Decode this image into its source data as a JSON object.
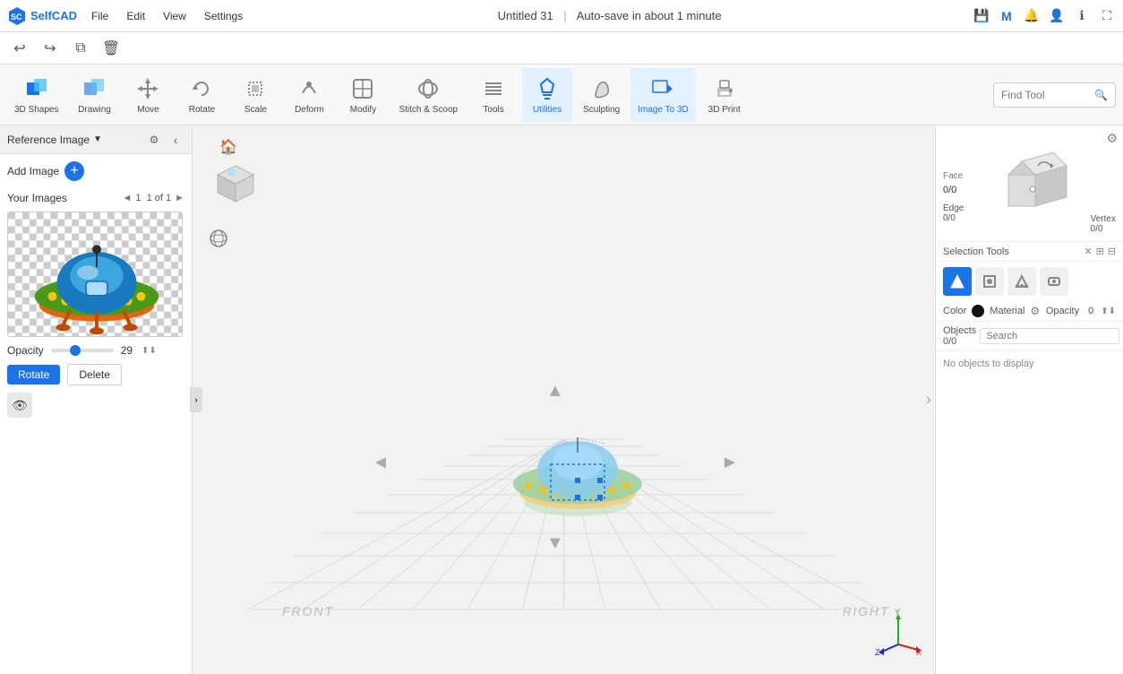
{
  "app": {
    "name": "SelfCAD",
    "title": "Untitled 31",
    "autosave": "Auto-save in about 1 minute"
  },
  "menubar": {
    "items": [
      "File",
      "Edit",
      "View",
      "Settings"
    ]
  },
  "toolbar": {
    "undo_label": "↩",
    "redo_label": "↪",
    "copy_label": "⧉",
    "delete_label": "🗑"
  },
  "main_toolbar": {
    "tools": [
      {
        "id": "3d-shapes",
        "label": "3D Shapes",
        "has_arrow": true
      },
      {
        "id": "drawing",
        "label": "Drawing",
        "has_arrow": true
      },
      {
        "id": "move",
        "label": "Move",
        "has_arrow": false
      },
      {
        "id": "rotate",
        "label": "Rotate",
        "has_arrow": false
      },
      {
        "id": "scale",
        "label": "Scale",
        "has_arrow": false
      },
      {
        "id": "deform",
        "label": "Deform",
        "has_arrow": true
      },
      {
        "id": "modify",
        "label": "Modify",
        "has_arrow": true
      },
      {
        "id": "stitch-scoop",
        "label": "Stitch & Scoop",
        "has_arrow": false
      },
      {
        "id": "tools",
        "label": "Tools",
        "has_arrow": true
      },
      {
        "id": "utilities",
        "label": "Utilities",
        "has_arrow": true,
        "active": true
      },
      {
        "id": "sculpting",
        "label": "Sculpting",
        "has_arrow": false
      },
      {
        "id": "image-to-3d",
        "label": "Image To 3D",
        "has_arrow": false
      },
      {
        "id": "3d-print",
        "label": "3D Print",
        "has_arrow": false
      }
    ],
    "find_placeholder": "Find Tool"
  },
  "left_panel": {
    "title": "Reference Image",
    "add_image_label": "Add Image",
    "your_images_label": "Your Images",
    "pagination": "1  1 of 1",
    "opacity_label": "Opacity",
    "opacity_value": "29",
    "rotate_btn": "Rotate",
    "delete_btn": "Delete"
  },
  "right_panel": {
    "face_label": "Face",
    "face_value": "0/0",
    "edge_label": "Edge",
    "edge_value": "0/0",
    "vertex_label": "Vertex",
    "vertex_value": "0/0",
    "selection_tools_label": "Selection Tools",
    "color_label": "Color",
    "material_label": "Material",
    "opacity_label": "Opacity",
    "opacity_value": "0",
    "objects_label": "Objects 0/0",
    "search_placeholder": "Search",
    "no_objects_label": "No objects to display"
  },
  "viewport": {
    "front_label": "FRONT",
    "right_label": "RIGHT"
  },
  "colors": {
    "active_blue": "#1a73e8",
    "bg_light": "#f5f5f5",
    "panel_bg": "#ffffff",
    "grid_line": "#d0d0d0"
  }
}
